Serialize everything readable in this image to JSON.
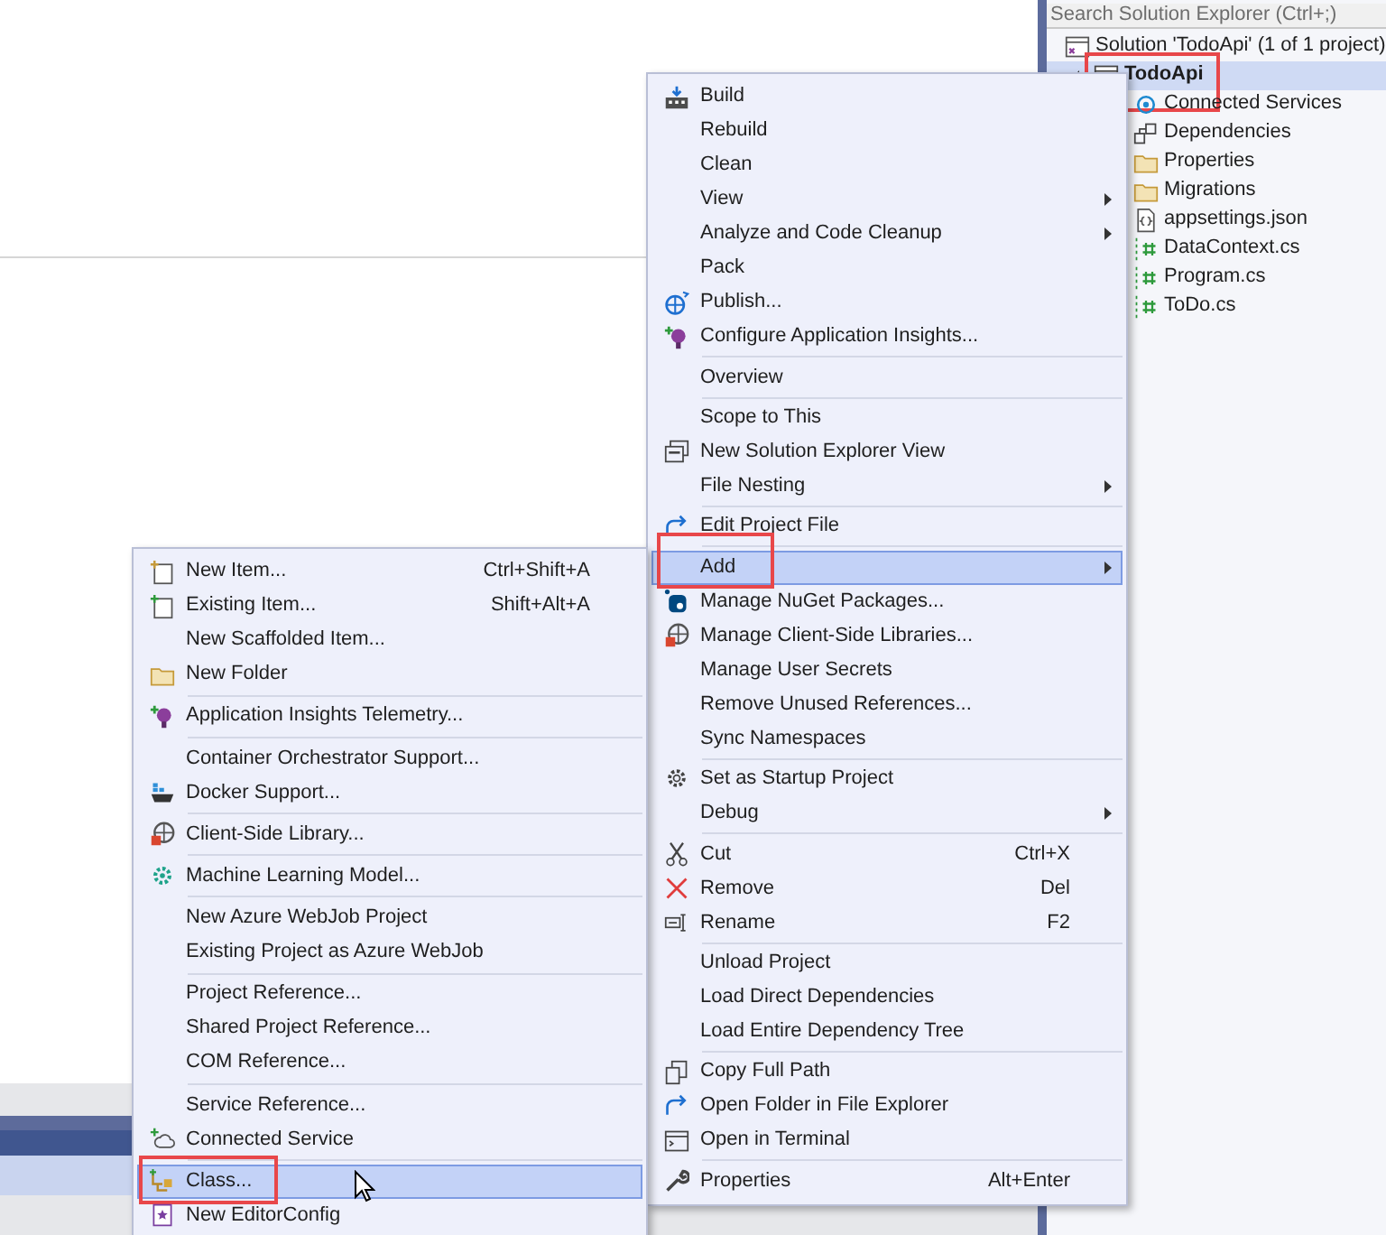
{
  "solution_explorer": {
    "search": {
      "placeholder": "Search Solution Explorer (Ctrl+;)"
    },
    "tree": [
      {
        "label": "Solution 'TodoApi' (1 of 1 project)",
        "selected": false,
        "highlighted": false,
        "children": [
          {
            "label": "TodoApi",
            "selected": true,
            "expanded": true,
            "highlighted": true,
            "children": [
              {
                "label": "Connected Services",
                "selected": false,
                "highlighted": false
              },
              {
                "label": "Dependencies",
                "selected": false,
                "highlighted": false
              },
              {
                "label": "Properties",
                "selected": false,
                "highlighted": false
              },
              {
                "label": "Migrations",
                "selected": false,
                "highlighted": false
              },
              {
                "label": "appsettings.json",
                "selected": false,
                "highlighted": false
              },
              {
                "label": "DataContext.cs",
                "selected": false,
                "highlighted": false
              },
              {
                "label": "Program.cs",
                "selected": false,
                "highlighted": false
              },
              {
                "label": "ToDo.cs",
                "selected": false,
                "highlighted": false
              }
            ]
          }
        ]
      }
    ]
  },
  "context_menu": {
    "groups": [
      [
        {
          "label": "Build",
          "selected": false,
          "submenu": false,
          "highlighted": false
        },
        {
          "label": "Rebuild",
          "selected": false,
          "submenu": false,
          "highlighted": false
        },
        {
          "label": "Clean",
          "selected": false,
          "submenu": false,
          "highlighted": false
        },
        {
          "label": "View",
          "selected": false,
          "submenu": true,
          "highlighted": false
        },
        {
          "label": "Analyze and Code Cleanup",
          "selected": false,
          "submenu": true,
          "highlighted": false
        },
        {
          "label": "Pack",
          "selected": false,
          "submenu": false,
          "highlighted": false
        },
        {
          "label": "Publish...",
          "selected": false,
          "submenu": false,
          "highlighted": false
        },
        {
          "label": "Configure Application Insights...",
          "selected": false,
          "submenu": false,
          "highlighted": false
        }
      ],
      [
        {
          "label": "Overview",
          "selected": false,
          "submenu": false,
          "highlighted": false
        }
      ],
      [
        {
          "label": "Scope to This",
          "selected": false,
          "submenu": false,
          "highlighted": false
        },
        {
          "label": "New Solution Explorer View",
          "selected": false,
          "submenu": false,
          "highlighted": false
        },
        {
          "label": "File Nesting",
          "selected": false,
          "submenu": true,
          "highlighted": false
        }
      ],
      [
        {
          "label": "Edit Project File",
          "selected": false,
          "submenu": false,
          "highlighted": false
        }
      ],
      [
        {
          "label": "Add",
          "selected": true,
          "submenu": true,
          "highlighted": true
        },
        {
          "label": "Manage NuGet Packages...",
          "selected": false,
          "submenu": false,
          "highlighted": false
        },
        {
          "label": "Manage Client-Side Libraries...",
          "selected": false,
          "submenu": false,
          "highlighted": false
        },
        {
          "label": "Manage User Secrets",
          "selected": false,
          "submenu": false,
          "highlighted": false
        },
        {
          "label": "Remove Unused References...",
          "selected": false,
          "submenu": false,
          "highlighted": false
        },
        {
          "label": "Sync Namespaces",
          "selected": false,
          "submenu": false,
          "highlighted": false
        }
      ],
      [
        {
          "label": "Set as Startup Project",
          "selected": false,
          "submenu": false,
          "highlighted": false
        },
        {
          "label": "Debug",
          "selected": false,
          "submenu": true,
          "highlighted": false
        }
      ],
      [
        {
          "label": "Cut",
          "shortcut": "Ctrl+X",
          "selected": false,
          "submenu": false,
          "highlighted": false
        },
        {
          "label": "Remove",
          "shortcut": "Del",
          "selected": false,
          "submenu": false,
          "highlighted": false
        },
        {
          "label": "Rename",
          "shortcut": "F2",
          "selected": false,
          "submenu": false,
          "highlighted": false
        }
      ],
      [
        {
          "label": "Unload Project",
          "selected": false,
          "submenu": false,
          "highlighted": false
        },
        {
          "label": "Load Direct Dependencies",
          "selected": false,
          "submenu": false,
          "highlighted": false
        },
        {
          "label": "Load Entire Dependency Tree",
          "selected": false,
          "submenu": false,
          "highlighted": false
        }
      ],
      [
        {
          "label": "Copy Full Path",
          "selected": false,
          "submenu": false,
          "highlighted": false
        },
        {
          "label": "Open Folder in File Explorer",
          "selected": false,
          "submenu": false,
          "highlighted": false
        },
        {
          "label": "Open in Terminal",
          "selected": false,
          "submenu": false,
          "highlighted": false
        }
      ],
      [
        {
          "label": "Properties",
          "shortcut": "Alt+Enter",
          "selected": false,
          "submenu": false,
          "highlighted": false
        }
      ]
    ]
  },
  "add_submenu": {
    "groups": [
      [
        {
          "label": "New Item...",
          "shortcut": "Ctrl+Shift+A",
          "selected": false,
          "submenu": false,
          "highlighted": false
        },
        {
          "label": "Existing Item...",
          "shortcut": "Shift+Alt+A",
          "selected": false,
          "submenu": false,
          "highlighted": false
        },
        {
          "label": "New Scaffolded Item...",
          "selected": false,
          "submenu": false,
          "highlighted": false
        },
        {
          "label": "New Folder",
          "selected": false,
          "submenu": false,
          "highlighted": false
        }
      ],
      [
        {
          "label": "Application Insights Telemetry...",
          "selected": false,
          "submenu": false,
          "highlighted": false
        }
      ],
      [
        {
          "label": "Container Orchestrator Support...",
          "selected": false,
          "submenu": false,
          "highlighted": false
        },
        {
          "label": "Docker Support...",
          "selected": false,
          "submenu": false,
          "highlighted": false
        }
      ],
      [
        {
          "label": "Client-Side Library...",
          "selected": false,
          "submenu": false,
          "highlighted": false
        }
      ],
      [
        {
          "label": "Machine Learning Model...",
          "selected": false,
          "submenu": false,
          "highlighted": false
        }
      ],
      [
        {
          "label": "New Azure WebJob Project",
          "selected": false,
          "submenu": false,
          "highlighted": false
        },
        {
          "label": "Existing Project as Azure WebJob",
          "selected": false,
          "submenu": false,
          "highlighted": false
        }
      ],
      [
        {
          "label": "Project Reference...",
          "selected": false,
          "submenu": false,
          "highlighted": false
        },
        {
          "label": "Shared Project Reference...",
          "selected": false,
          "submenu": false,
          "highlighted": false
        },
        {
          "label": "COM Reference...",
          "selected": false,
          "submenu": false,
          "highlighted": false
        }
      ],
      [
        {
          "label": "Service Reference...",
          "selected": false,
          "submenu": false,
          "highlighted": false
        },
        {
          "label": "Connected Service",
          "selected": false,
          "submenu": false,
          "highlighted": false
        }
      ],
      [
        {
          "label": "Class...",
          "selected": true,
          "submenu": false,
          "highlighted": true
        },
        {
          "label": "New EditorConfig",
          "selected": false,
          "submenu": false,
          "highlighted": false
        }
      ]
    ]
  }
}
